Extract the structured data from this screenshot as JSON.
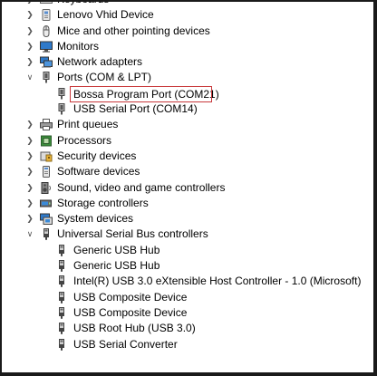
{
  "tree": {
    "items": [
      {
        "label": "Keyboards",
        "state": "collapsed",
        "icon": "keyboard-icon"
      },
      {
        "label": "Lenovo Vhid Device",
        "state": "collapsed",
        "icon": "hid-device-icon"
      },
      {
        "label": "Mice and other pointing devices",
        "state": "collapsed",
        "icon": "mouse-icon"
      },
      {
        "label": "Monitors",
        "state": "collapsed",
        "icon": "monitor-icon"
      },
      {
        "label": "Network adapters",
        "state": "collapsed",
        "icon": "network-adapter-icon"
      },
      {
        "label": "Ports (COM & LPT)",
        "state": "expanded",
        "icon": "port-icon",
        "children": [
          {
            "label": "Bossa Program Port (COM21)",
            "icon": "port-icon",
            "selected": true
          },
          {
            "label": "USB Serial Port (COM14)",
            "icon": "port-icon"
          }
        ]
      },
      {
        "label": "Print queues",
        "state": "collapsed",
        "icon": "printer-icon"
      },
      {
        "label": "Processors",
        "state": "collapsed",
        "icon": "processor-icon"
      },
      {
        "label": "Security devices",
        "state": "collapsed",
        "icon": "security-device-icon"
      },
      {
        "label": "Software devices",
        "state": "collapsed",
        "icon": "software-device-icon"
      },
      {
        "label": "Sound, video and game controllers",
        "state": "collapsed",
        "icon": "speaker-icon"
      },
      {
        "label": "Storage controllers",
        "state": "collapsed",
        "icon": "storage-icon"
      },
      {
        "label": "System devices",
        "state": "collapsed",
        "icon": "system-device-icon"
      },
      {
        "label": "Universal Serial Bus controllers",
        "state": "expanded",
        "icon": "usb-icon",
        "children": [
          {
            "label": "Generic USB Hub",
            "icon": "usb-icon"
          },
          {
            "label": "Generic USB Hub",
            "icon": "usb-icon"
          },
          {
            "label": "Intel(R) USB 3.0 eXtensible Host Controller - 1.0 (Microsoft)",
            "icon": "usb-icon"
          },
          {
            "label": "USB Composite Device",
            "icon": "usb-icon"
          },
          {
            "label": "USB Composite Device",
            "icon": "usb-icon"
          },
          {
            "label": "USB Root Hub (USB 3.0)",
            "icon": "usb-icon"
          },
          {
            "label": "USB Serial Converter",
            "icon": "usb-icon"
          }
        ]
      }
    ]
  },
  "colors": {
    "selection_outline": "#c8383b",
    "arrow": "#555555"
  }
}
